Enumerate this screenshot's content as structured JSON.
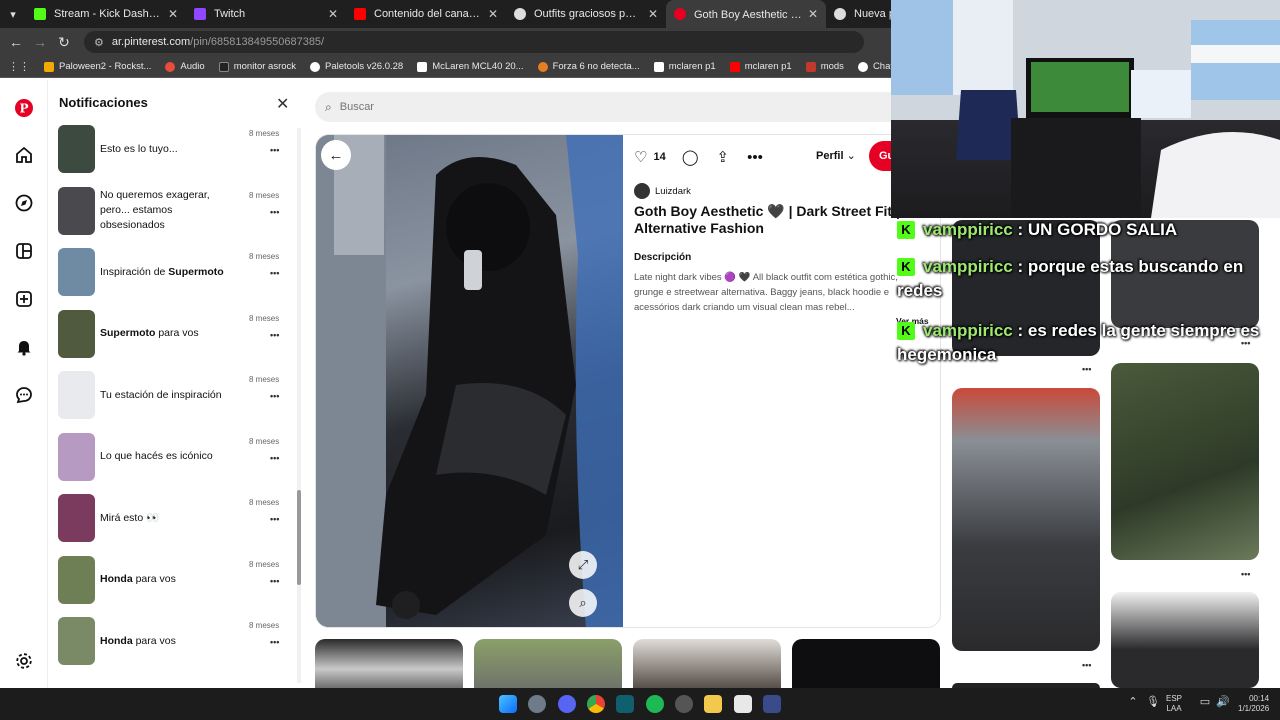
{
  "browser": {
    "tabs": [
      {
        "title": "Stream - Kick Dashboard",
        "color": "#53fc18"
      },
      {
        "title": "Twitch",
        "color": "#9146ff"
      },
      {
        "title": "Contenido del canal - YouTube",
        "color": "#ff0000"
      },
      {
        "title": "Outfits graciosos para stream",
        "color": "#dddddd"
      },
      {
        "title": "Goth Boy Aesthetic 🖤 | Dark S",
        "color": "#e60023"
      },
      {
        "title": "Nueva pestaña",
        "color": "#dddddd"
      }
    ],
    "url_host": "ar.pinterest.com",
    "url_path": "/pin/685813849550687385/",
    "bookmarks": [
      {
        "label": "Paloween2 - Rockst...",
        "color": "#f2a900"
      },
      {
        "label": "Audio",
        "color": "#e74c3c"
      },
      {
        "label": "monitor asrock",
        "color": "#222222"
      },
      {
        "label": "Paletools v26.0.28",
        "color": "#ffffff"
      },
      {
        "label": "McLaren MCL40 20...",
        "color": "#ffffff"
      },
      {
        "label": "Forza 6 no detecta...",
        "color": "#e67e22"
      },
      {
        "label": "mclaren p1",
        "color": "#ffffff"
      },
      {
        "label": "mclaren p1",
        "color": "#ff0000"
      },
      {
        "label": "mods",
        "color": "#c0392b"
      },
      {
        "label": "ChatGPT",
        "color": "#ffffff"
      }
    ]
  },
  "notifications": {
    "title": "Notificaciones",
    "items": [
      {
        "pre": "Esto es lo tuyo...",
        "bold": "",
        "post": "",
        "time": "8 meses",
        "thumb": "#3d4a3f"
      },
      {
        "pre": "No queremos exagerar, pero... estamos obsesionados",
        "bold": "",
        "post": "",
        "time": "8 meses",
        "thumb": "#4a4a4e"
      },
      {
        "pre": "Inspiración de ",
        "bold": "Supermoto",
        "post": "",
        "time": "8 meses",
        "thumb": "#6f8aa3"
      },
      {
        "pre": "",
        "bold": "Supermoto",
        "post": " para vos",
        "time": "8 meses",
        "thumb": "#4f5a3f"
      },
      {
        "pre": "Tu estación de inspiración",
        "bold": "",
        "post": "",
        "time": "8 meses",
        "thumb": "#e8eaee"
      },
      {
        "pre": "Lo que hacés es icónico",
        "bold": "",
        "post": "",
        "time": "8 meses",
        "thumb": "#b79ac2"
      },
      {
        "pre": "Mirá esto 👀",
        "bold": "",
        "post": "",
        "time": "8 meses",
        "thumb": "#7a3b5e"
      },
      {
        "pre": "",
        "bold": "Honda",
        "post": " para vos",
        "time": "8 meses",
        "thumb": "#6f7f55"
      },
      {
        "pre": "",
        "bold": "Honda",
        "post": " para vos",
        "time": "8 meses",
        "thumb": "#7a8a66"
      }
    ]
  },
  "search": {
    "placeholder": "Buscar"
  },
  "pin": {
    "likes": "14",
    "board": "Perfil",
    "save": "Guardar",
    "author": "Luizdark",
    "title": "Goth Boy Aesthetic 🖤 | Dark Street Fit | Alternative Fashion",
    "desc_heading": "Descripción",
    "description": "Late night dark vibes 🟣 🖤 All black outfit com estética gothic, grunge e streetwear alternativa. Baggy jeans, black hoodie e acessórios dark criando um visual clean mas rebel...",
    "more": "Ver más"
  },
  "chat": [
    {
      "user": "vamppiricc",
      "msg": " : UN GORDO SALIA"
    },
    {
      "user": "vamppiricc",
      "msg": " : porque estas buscando en redes"
    },
    {
      "user": "vamppiricc",
      "msg": " : es redes la gente siempre es hegemonica"
    }
  ],
  "taskbar": {
    "lang1": "ESP",
    "lang2": "LAA",
    "time": "00:14",
    "date": "1/1/2026"
  }
}
